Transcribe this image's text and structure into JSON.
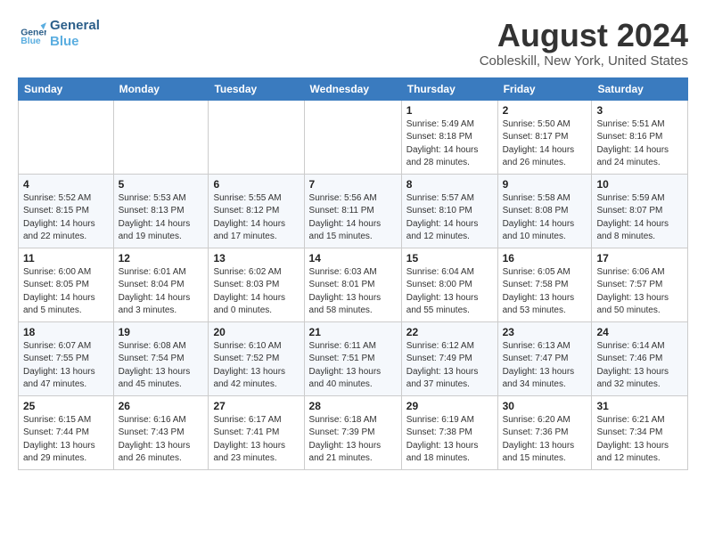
{
  "header": {
    "logo_line1": "General",
    "logo_line2": "Blue",
    "month_year": "August 2024",
    "location": "Cobleskill, New York, United States"
  },
  "weekdays": [
    "Sunday",
    "Monday",
    "Tuesday",
    "Wednesday",
    "Thursday",
    "Friday",
    "Saturday"
  ],
  "weeks": [
    [
      {
        "day": "",
        "info": ""
      },
      {
        "day": "",
        "info": ""
      },
      {
        "day": "",
        "info": ""
      },
      {
        "day": "",
        "info": ""
      },
      {
        "day": "1",
        "info": "Sunrise: 5:49 AM\nSunset: 8:18 PM\nDaylight: 14 hours\nand 28 minutes."
      },
      {
        "day": "2",
        "info": "Sunrise: 5:50 AM\nSunset: 8:17 PM\nDaylight: 14 hours\nand 26 minutes."
      },
      {
        "day": "3",
        "info": "Sunrise: 5:51 AM\nSunset: 8:16 PM\nDaylight: 14 hours\nand 24 minutes."
      }
    ],
    [
      {
        "day": "4",
        "info": "Sunrise: 5:52 AM\nSunset: 8:15 PM\nDaylight: 14 hours\nand 22 minutes."
      },
      {
        "day": "5",
        "info": "Sunrise: 5:53 AM\nSunset: 8:13 PM\nDaylight: 14 hours\nand 19 minutes."
      },
      {
        "day": "6",
        "info": "Sunrise: 5:55 AM\nSunset: 8:12 PM\nDaylight: 14 hours\nand 17 minutes."
      },
      {
        "day": "7",
        "info": "Sunrise: 5:56 AM\nSunset: 8:11 PM\nDaylight: 14 hours\nand 15 minutes."
      },
      {
        "day": "8",
        "info": "Sunrise: 5:57 AM\nSunset: 8:10 PM\nDaylight: 14 hours\nand 12 minutes."
      },
      {
        "day": "9",
        "info": "Sunrise: 5:58 AM\nSunset: 8:08 PM\nDaylight: 14 hours\nand 10 minutes."
      },
      {
        "day": "10",
        "info": "Sunrise: 5:59 AM\nSunset: 8:07 PM\nDaylight: 14 hours\nand 8 minutes."
      }
    ],
    [
      {
        "day": "11",
        "info": "Sunrise: 6:00 AM\nSunset: 8:05 PM\nDaylight: 14 hours\nand 5 minutes."
      },
      {
        "day": "12",
        "info": "Sunrise: 6:01 AM\nSunset: 8:04 PM\nDaylight: 14 hours\nand 3 minutes."
      },
      {
        "day": "13",
        "info": "Sunrise: 6:02 AM\nSunset: 8:03 PM\nDaylight: 14 hours\nand 0 minutes."
      },
      {
        "day": "14",
        "info": "Sunrise: 6:03 AM\nSunset: 8:01 PM\nDaylight: 13 hours\nand 58 minutes."
      },
      {
        "day": "15",
        "info": "Sunrise: 6:04 AM\nSunset: 8:00 PM\nDaylight: 13 hours\nand 55 minutes."
      },
      {
        "day": "16",
        "info": "Sunrise: 6:05 AM\nSunset: 7:58 PM\nDaylight: 13 hours\nand 53 minutes."
      },
      {
        "day": "17",
        "info": "Sunrise: 6:06 AM\nSunset: 7:57 PM\nDaylight: 13 hours\nand 50 minutes."
      }
    ],
    [
      {
        "day": "18",
        "info": "Sunrise: 6:07 AM\nSunset: 7:55 PM\nDaylight: 13 hours\nand 47 minutes."
      },
      {
        "day": "19",
        "info": "Sunrise: 6:08 AM\nSunset: 7:54 PM\nDaylight: 13 hours\nand 45 minutes."
      },
      {
        "day": "20",
        "info": "Sunrise: 6:10 AM\nSunset: 7:52 PM\nDaylight: 13 hours\nand 42 minutes."
      },
      {
        "day": "21",
        "info": "Sunrise: 6:11 AM\nSunset: 7:51 PM\nDaylight: 13 hours\nand 40 minutes."
      },
      {
        "day": "22",
        "info": "Sunrise: 6:12 AM\nSunset: 7:49 PM\nDaylight: 13 hours\nand 37 minutes."
      },
      {
        "day": "23",
        "info": "Sunrise: 6:13 AM\nSunset: 7:47 PM\nDaylight: 13 hours\nand 34 minutes."
      },
      {
        "day": "24",
        "info": "Sunrise: 6:14 AM\nSunset: 7:46 PM\nDaylight: 13 hours\nand 32 minutes."
      }
    ],
    [
      {
        "day": "25",
        "info": "Sunrise: 6:15 AM\nSunset: 7:44 PM\nDaylight: 13 hours\nand 29 minutes."
      },
      {
        "day": "26",
        "info": "Sunrise: 6:16 AM\nSunset: 7:43 PM\nDaylight: 13 hours\nand 26 minutes."
      },
      {
        "day": "27",
        "info": "Sunrise: 6:17 AM\nSunset: 7:41 PM\nDaylight: 13 hours\nand 23 minutes."
      },
      {
        "day": "28",
        "info": "Sunrise: 6:18 AM\nSunset: 7:39 PM\nDaylight: 13 hours\nand 21 minutes."
      },
      {
        "day": "29",
        "info": "Sunrise: 6:19 AM\nSunset: 7:38 PM\nDaylight: 13 hours\nand 18 minutes."
      },
      {
        "day": "30",
        "info": "Sunrise: 6:20 AM\nSunset: 7:36 PM\nDaylight: 13 hours\nand 15 minutes."
      },
      {
        "day": "31",
        "info": "Sunrise: 6:21 AM\nSunset: 7:34 PM\nDaylight: 13 hours\nand 12 minutes."
      }
    ]
  ]
}
